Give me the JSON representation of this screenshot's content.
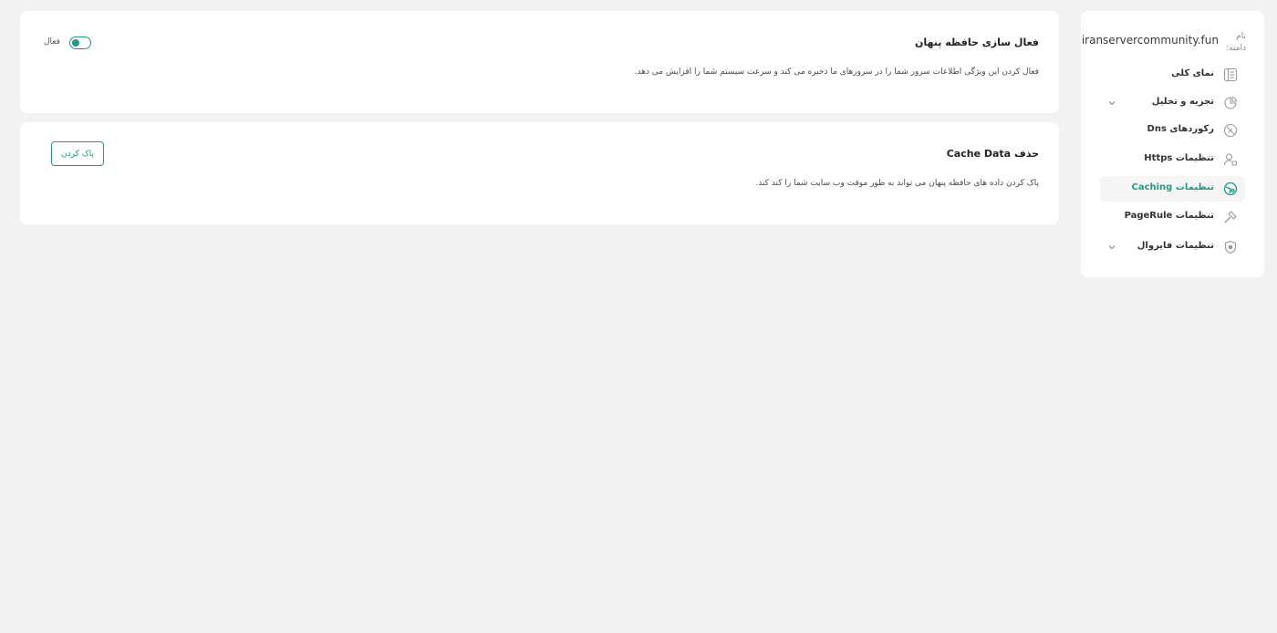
{
  "sidebar": {
    "domain_label": "نام دامنه:",
    "domain_value": "iranservercommunity.fun",
    "items": [
      {
        "label": "نمای کلی",
        "icon": "overview-icon",
        "has_chevron": false,
        "active": false
      },
      {
        "label": "تجزیه و تحلیل",
        "icon": "analytics-icon",
        "has_chevron": true,
        "active": false
      },
      {
        "label": "رکوردهای Dns",
        "icon": "dns-icon",
        "has_chevron": false,
        "active": false
      },
      {
        "label": "تنظیمات Https",
        "icon": "https-icon",
        "has_chevron": false,
        "active": false
      },
      {
        "label": "تنظیمات Caching",
        "icon": "caching-icon",
        "has_chevron": false,
        "active": true
      },
      {
        "label": "تنظیمات PageRule",
        "icon": "pagerule-icon",
        "has_chevron": false,
        "active": false
      },
      {
        "label": "تنظیمات فایروال",
        "icon": "firewall-icon",
        "has_chevron": true,
        "active": false
      }
    ]
  },
  "cache_card": {
    "title": "فعال سازی حافظه پنهان",
    "description": "فعال کردن این ویژگی اطلاعات سرور شما را در سرورهای ما ذخیره می کند و سرعت سیستم شما را افزایش می دهد.",
    "toggle_label": "فعال",
    "toggle_on": true
  },
  "clear_card": {
    "title": "حذف Cache Data",
    "description": "پاک کردن داده های حافظه پنهان می تواند به طور موقت وب سایت شما را کند کند.",
    "button_label": "پاک کردن"
  },
  "colors": {
    "accent": "#1f9a85",
    "background": "#f2f2f2",
    "card": "#ffffff"
  }
}
